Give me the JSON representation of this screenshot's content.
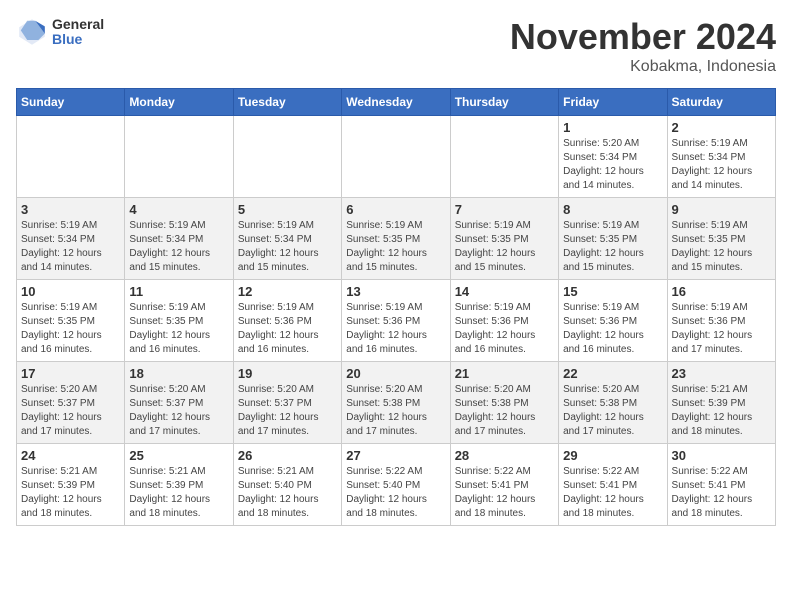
{
  "logo": {
    "general": "General",
    "blue": "Blue"
  },
  "header": {
    "month": "November 2024",
    "location": "Kobakma, Indonesia"
  },
  "weekdays": [
    "Sunday",
    "Monday",
    "Tuesday",
    "Wednesday",
    "Thursday",
    "Friday",
    "Saturday"
  ],
  "weeks": [
    [
      {
        "day": "",
        "info": ""
      },
      {
        "day": "",
        "info": ""
      },
      {
        "day": "",
        "info": ""
      },
      {
        "day": "",
        "info": ""
      },
      {
        "day": "",
        "info": ""
      },
      {
        "day": "1",
        "info": "Sunrise: 5:20 AM\nSunset: 5:34 PM\nDaylight: 12 hours and 14 minutes."
      },
      {
        "day": "2",
        "info": "Sunrise: 5:19 AM\nSunset: 5:34 PM\nDaylight: 12 hours and 14 minutes."
      }
    ],
    [
      {
        "day": "3",
        "info": "Sunrise: 5:19 AM\nSunset: 5:34 PM\nDaylight: 12 hours and 14 minutes."
      },
      {
        "day": "4",
        "info": "Sunrise: 5:19 AM\nSunset: 5:34 PM\nDaylight: 12 hours and 15 minutes."
      },
      {
        "day": "5",
        "info": "Sunrise: 5:19 AM\nSunset: 5:34 PM\nDaylight: 12 hours and 15 minutes."
      },
      {
        "day": "6",
        "info": "Sunrise: 5:19 AM\nSunset: 5:35 PM\nDaylight: 12 hours and 15 minutes."
      },
      {
        "day": "7",
        "info": "Sunrise: 5:19 AM\nSunset: 5:35 PM\nDaylight: 12 hours and 15 minutes."
      },
      {
        "day": "8",
        "info": "Sunrise: 5:19 AM\nSunset: 5:35 PM\nDaylight: 12 hours and 15 minutes."
      },
      {
        "day": "9",
        "info": "Sunrise: 5:19 AM\nSunset: 5:35 PM\nDaylight: 12 hours and 15 minutes."
      }
    ],
    [
      {
        "day": "10",
        "info": "Sunrise: 5:19 AM\nSunset: 5:35 PM\nDaylight: 12 hours and 16 minutes."
      },
      {
        "day": "11",
        "info": "Sunrise: 5:19 AM\nSunset: 5:35 PM\nDaylight: 12 hours and 16 minutes."
      },
      {
        "day": "12",
        "info": "Sunrise: 5:19 AM\nSunset: 5:36 PM\nDaylight: 12 hours and 16 minutes."
      },
      {
        "day": "13",
        "info": "Sunrise: 5:19 AM\nSunset: 5:36 PM\nDaylight: 12 hours and 16 minutes."
      },
      {
        "day": "14",
        "info": "Sunrise: 5:19 AM\nSunset: 5:36 PM\nDaylight: 12 hours and 16 minutes."
      },
      {
        "day": "15",
        "info": "Sunrise: 5:19 AM\nSunset: 5:36 PM\nDaylight: 12 hours and 16 minutes."
      },
      {
        "day": "16",
        "info": "Sunrise: 5:19 AM\nSunset: 5:36 PM\nDaylight: 12 hours and 17 minutes."
      }
    ],
    [
      {
        "day": "17",
        "info": "Sunrise: 5:20 AM\nSunset: 5:37 PM\nDaylight: 12 hours and 17 minutes."
      },
      {
        "day": "18",
        "info": "Sunrise: 5:20 AM\nSunset: 5:37 PM\nDaylight: 12 hours and 17 minutes."
      },
      {
        "day": "19",
        "info": "Sunrise: 5:20 AM\nSunset: 5:37 PM\nDaylight: 12 hours and 17 minutes."
      },
      {
        "day": "20",
        "info": "Sunrise: 5:20 AM\nSunset: 5:38 PM\nDaylight: 12 hours and 17 minutes."
      },
      {
        "day": "21",
        "info": "Sunrise: 5:20 AM\nSunset: 5:38 PM\nDaylight: 12 hours and 17 minutes."
      },
      {
        "day": "22",
        "info": "Sunrise: 5:20 AM\nSunset: 5:38 PM\nDaylight: 12 hours and 17 minutes."
      },
      {
        "day": "23",
        "info": "Sunrise: 5:21 AM\nSunset: 5:39 PM\nDaylight: 12 hours and 18 minutes."
      }
    ],
    [
      {
        "day": "24",
        "info": "Sunrise: 5:21 AM\nSunset: 5:39 PM\nDaylight: 12 hours and 18 minutes."
      },
      {
        "day": "25",
        "info": "Sunrise: 5:21 AM\nSunset: 5:39 PM\nDaylight: 12 hours and 18 minutes."
      },
      {
        "day": "26",
        "info": "Sunrise: 5:21 AM\nSunset: 5:40 PM\nDaylight: 12 hours and 18 minutes."
      },
      {
        "day": "27",
        "info": "Sunrise: 5:22 AM\nSunset: 5:40 PM\nDaylight: 12 hours and 18 minutes."
      },
      {
        "day": "28",
        "info": "Sunrise: 5:22 AM\nSunset: 5:41 PM\nDaylight: 12 hours and 18 minutes."
      },
      {
        "day": "29",
        "info": "Sunrise: 5:22 AM\nSunset: 5:41 PM\nDaylight: 12 hours and 18 minutes."
      },
      {
        "day": "30",
        "info": "Sunrise: 5:22 AM\nSunset: 5:41 PM\nDaylight: 12 hours and 18 minutes."
      }
    ]
  ]
}
